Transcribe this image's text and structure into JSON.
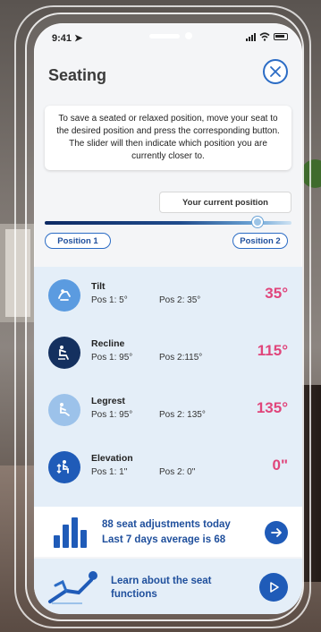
{
  "status": {
    "time": "9:41"
  },
  "header": {
    "title": "Seating"
  },
  "info_text": "To save a seated or relaxed position, move your seat to the desired position and press the corresponding button. The slider will then indicate which position you are currently closer to.",
  "slider": {
    "current_label": "Your current position",
    "value_fraction": 0.88
  },
  "buttons": {
    "position1": "Position 1",
    "position2": "Position 2"
  },
  "adjustments": [
    {
      "name": "Tilt",
      "pos1": "Pos 1: 5°",
      "pos2": "Pos 2: 35°",
      "value": "35°",
      "icon": "tilt-icon"
    },
    {
      "name": "Recline",
      "pos1": "Pos 1: 95°",
      "pos2": "Pos 2:115°",
      "value": "115°",
      "icon": "recline-icon"
    },
    {
      "name": "Legrest",
      "pos1": "Pos 1: 95°",
      "pos2": "Pos 2: 135°",
      "value": "135°",
      "icon": "legrest-icon"
    },
    {
      "name": "Elevation",
      "pos1": "Pos 1: 1\"",
      "pos2": "Pos 2: 0\"",
      "value": "0\"",
      "icon": "elevation-icon"
    }
  ],
  "stats": {
    "count": "88",
    "count_text": " seat adjustments today",
    "avg_text": "Last 7 days average is ",
    "avg": "68"
  },
  "learn": {
    "text": "Learn about the seat functions"
  },
  "colors": {
    "accent": "#1f5bb8",
    "value": "#e0457b",
    "list_bg": "#e4eef8"
  }
}
